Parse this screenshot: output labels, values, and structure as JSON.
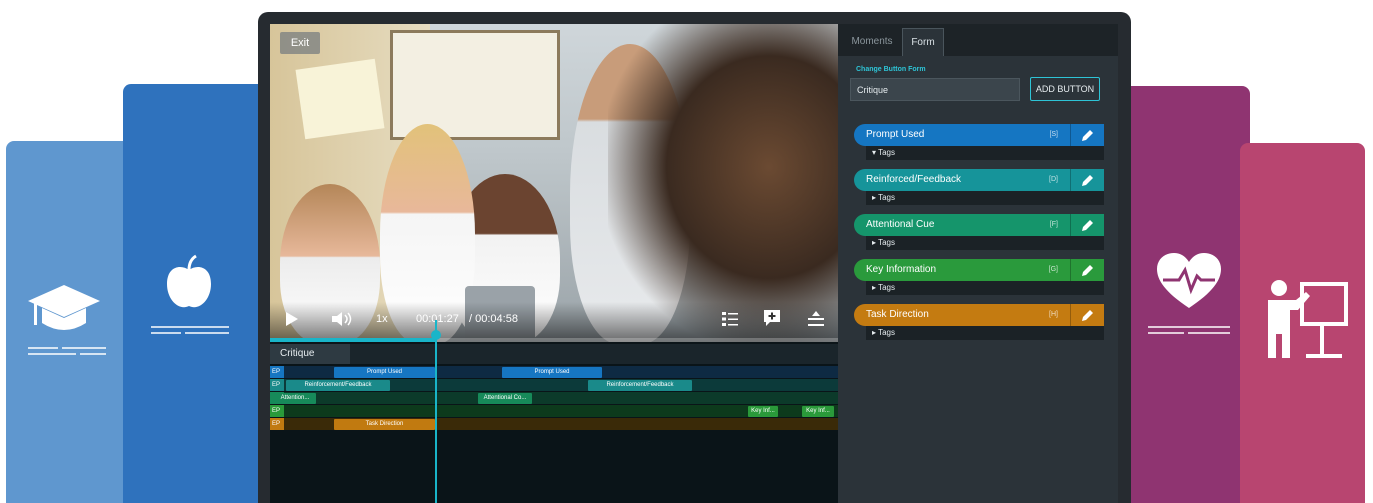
{
  "player": {
    "exit_label": "Exit",
    "speed": "1x",
    "current_time": "00:01:27",
    "duration": "/ 00:04:58",
    "progress": 0.29
  },
  "timeline": {
    "tab_label": "Critique",
    "tracks": [
      {
        "label": "EP",
        "color": "#0e2a43",
        "segments": [
          {
            "label": "Prompt Used",
            "color": "#1676c2"
          },
          {
            "label": "Prompt Used",
            "color": "#1676c2"
          }
        ]
      },
      {
        "label": "EP",
        "color": "#0c3a3a",
        "segments": [
          {
            "label": "Reinforcement/Feedback",
            "color": "#1a8a8a"
          },
          {
            "label": "Reinforcement/Feedback",
            "color": "#1a8a8a"
          }
        ]
      },
      {
        "label": "",
        "color": "#0c3a2a",
        "segments": [
          {
            "label": "Attention...",
            "color": "#178a5a"
          },
          {
            "label": "Attentional Co...",
            "color": "#178a5a"
          }
        ]
      },
      {
        "label": "EP",
        "color": "#0d3a1c",
        "segments": [
          {
            "label": "Key Inf...",
            "color": "#2a9a3a"
          },
          {
            "label": "Key Inf...",
            "color": "#2a9a3a"
          }
        ]
      },
      {
        "label": "EP",
        "color": "#3a2a08",
        "segments": [
          {
            "label": "Task Direction",
            "color": "#c17a10"
          }
        ]
      }
    ]
  },
  "panel": {
    "tabs": [
      "Moments",
      "Form"
    ],
    "active_tab": "Form",
    "form_label": "Change Button Form",
    "form_value": "Critique",
    "add_button_label": "ADD BUTTON",
    "categories": [
      {
        "name": "Prompt Used",
        "key": "[S]",
        "color": "#1576c2",
        "tags": "▾ Tags"
      },
      {
        "name": "Reinforced/Feedback",
        "key": "[D]",
        "color": "#16949a",
        "tags": "▸ Tags"
      },
      {
        "name": "Attentional Cue",
        "key": "[F]",
        "color": "#15956b",
        "tags": "▸ Tags"
      },
      {
        "name": "Key Information",
        "key": "[G]",
        "color": "#2a9a3c",
        "tags": "▸ Tags"
      },
      {
        "name": "Task Direction",
        "key": "[H]",
        "color": "#c47b11",
        "tags": "▸ Tags"
      }
    ]
  },
  "background_cards": [
    {
      "icon": "graduation-cap-icon",
      "color": "#5f97cf"
    },
    {
      "icon": "apple-icon",
      "color": "#2f72bd"
    },
    {
      "icon": "heart-pulse-icon",
      "color": "#8f3471"
    },
    {
      "icon": "teacher-board-icon",
      "color": "#b84570"
    }
  ]
}
